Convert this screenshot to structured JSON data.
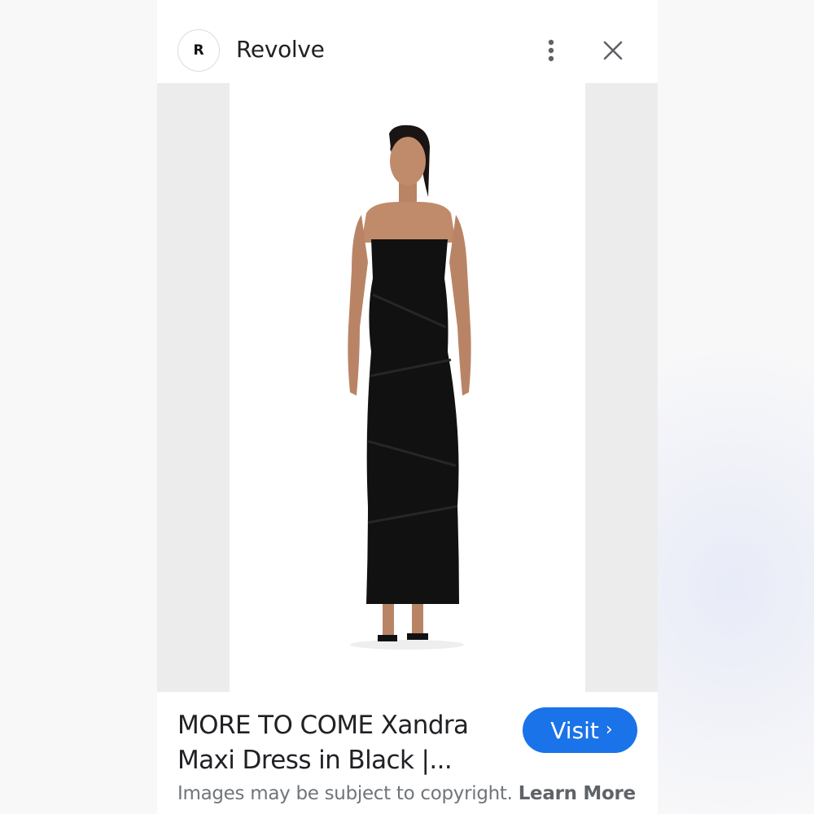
{
  "header": {
    "logo_letter": "R",
    "source_name": "Revolve",
    "more_icon": "more-vert-icon",
    "close_icon": "close-icon"
  },
  "image": {
    "description_icon": "product-photo"
  },
  "footer": {
    "title": "MORE TO COME Xandra Maxi Dress in Black |...",
    "visit_label": "Visit",
    "visit_chevron": "›",
    "copyright_text": "Images may be subject to copyright.",
    "learn_more_label": "Learn More"
  },
  "colors": {
    "accent": "#1a73e8",
    "text_primary": "#202124",
    "text_secondary": "#70757a",
    "image_margin_bg": "#ececec"
  }
}
